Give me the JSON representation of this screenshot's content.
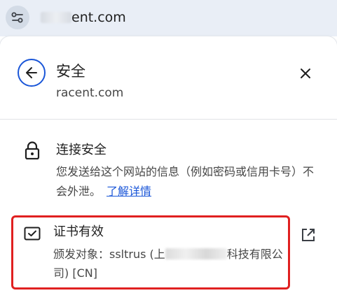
{
  "addressbar": {
    "url_visible": "ent.com",
    "site_settings_icon": "tune-icon"
  },
  "panel": {
    "title": "安全",
    "domain": "racent.com",
    "back_icon": "arrow-back-icon",
    "close_icon": "close-icon"
  },
  "connection": {
    "icon": "lock-icon",
    "title": "连接安全",
    "description": "您发送给这个网站的信息（例如密码或信用卡号）不会外泄。",
    "learn_more": "了解详情"
  },
  "certificate": {
    "icon": "certificate-icon",
    "title": "证书有效",
    "issued_to_prefix": "颁发对象：ssltrus (上",
    "issued_to_suffix": "科技有限公司) [CN]",
    "open_icon": "open-in-new-icon"
  },
  "colors": {
    "accent": "#1a56d8",
    "highlight_box": "#e02020",
    "address_bar_bg": "#e9eef6"
  }
}
